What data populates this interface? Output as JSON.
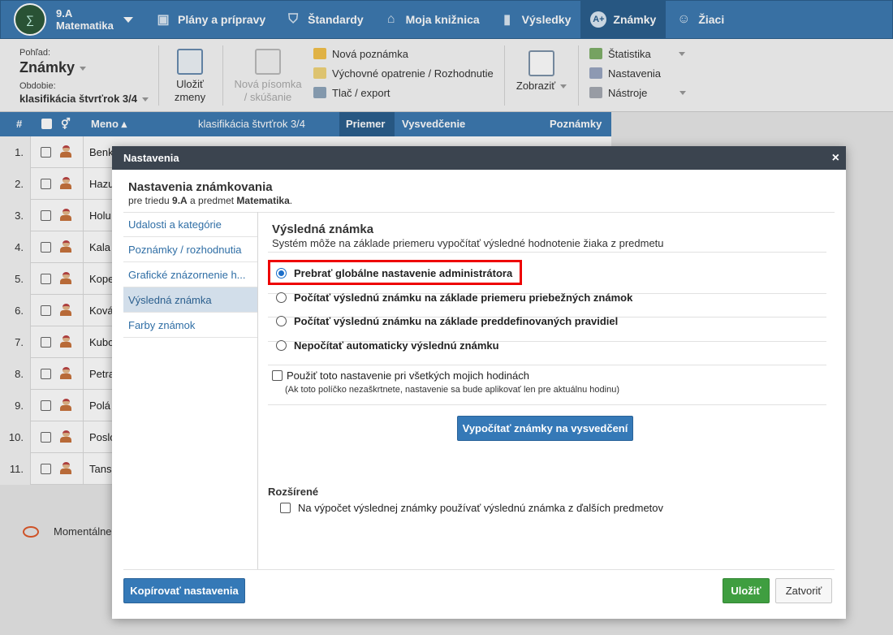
{
  "topnav": {
    "class_name": "9.A",
    "subject": "Matematika",
    "items": [
      {
        "label": "Plány a prípravy",
        "icon": "briefcase-icon"
      },
      {
        "label": "Štandardy",
        "icon": "shield-icon"
      },
      {
        "label": "Moja knižnica",
        "icon": "library-icon"
      },
      {
        "label": "Výsledky",
        "icon": "bar-chart-icon"
      },
      {
        "label": "Známky",
        "icon": "grade-icon"
      },
      {
        "label": "Žiaci",
        "icon": "students-icon"
      }
    ]
  },
  "toolbar": {
    "view_label": "Pohľad:",
    "view_value": "Známky",
    "period_label": "Obdobie:",
    "period_value": "klasifikácia štvrťrok 3/4",
    "save_l1": "Uložiť",
    "save_l2": "zmeny",
    "newtest_l1": "Nová písomka",
    "newtest_l2": "/ skúšanie",
    "new_note": "Nová poznámka",
    "edu_measure": "Výchovné opatrenie / Rozhodnutie",
    "print_export": "Tlač / export",
    "show": "Zobraziť",
    "stats": "Štatistika",
    "settings": "Nastavenia",
    "tools": "Nástroje"
  },
  "grid": {
    "headers": {
      "num": "#",
      "name": "Meno",
      "period": "klasifikácia štvrťrok 3/4",
      "avg": "Priemer",
      "report": "Vysvedčenie",
      "notes": "Poznámky"
    },
    "rows": [
      {
        "n": "1.",
        "name": "Benk"
      },
      {
        "n": "2.",
        "name": "Hazu"
      },
      {
        "n": "3.",
        "name": "Holu"
      },
      {
        "n": "4.",
        "name": "Kala"
      },
      {
        "n": "5.",
        "name": "Kope"
      },
      {
        "n": "6.",
        "name": "Ková"
      },
      {
        "n": "7.",
        "name": "Kubo"
      },
      {
        "n": "8.",
        "name": "Petra"
      },
      {
        "n": "9.",
        "name": "Polá"
      },
      {
        "n": "10.",
        "name": "Poslo"
      },
      {
        "n": "11.",
        "name": "Tans"
      }
    ],
    "moment_text": "Momentálne"
  },
  "modal": {
    "header": "Nastavenia",
    "close": "×",
    "title": "Nastavenia známkovania",
    "sub_pre": "pre triedu ",
    "sub_class": "9.A",
    "sub_mid": " a predmet ",
    "sub_subject": "Matematika",
    "sub_end": ".",
    "sidebar": [
      "Udalosti a kategórie",
      "Poznámky / rozhodnutia",
      "Grafické znázornenie h...",
      "Výsledná známka",
      "Farby známok"
    ],
    "section_title": "Výsledná známka",
    "section_sub": "Systém môže na základe priemeru vypočítať výsledné hodnotenie žiaka z predmetu",
    "options": [
      "Prebrať globálne nastavenie administrátora",
      "Počítať výslednú známku na základe priemeru priebežných známok",
      "Počítať výslednú známku na základe preddefinovaných pravidiel",
      "Nepočítať automaticky výslednú známku"
    ],
    "apply_all": "Použiť toto nastavenie pri všetkých mojich hodinách",
    "apply_note": "(Ak toto políčko nezaškrtnete, nastavenie sa bude aplikovať len pre aktuálnu hodinu)",
    "calc_button": "Vypočítať známky na vysvedčení",
    "advanced": "Rozšírené",
    "advanced_option": "Na výpočet výslednej známky používať výslednú známka z ďalších predmetov",
    "copy_button": "Kopírovať nastavenia",
    "save_button": "Uložiť",
    "close_button": "Zatvoriť"
  }
}
